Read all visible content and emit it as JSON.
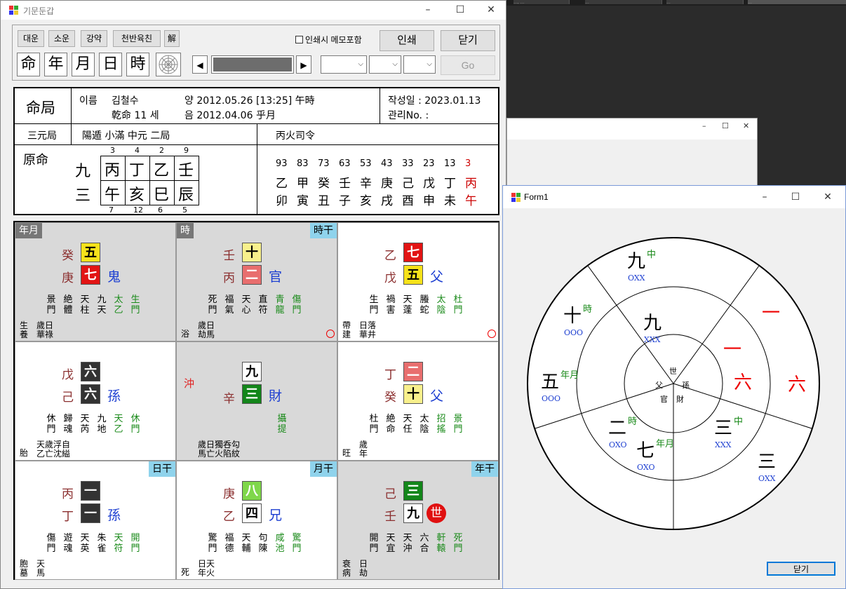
{
  "taskbar_tabs": [
    "..., ...",
    "...",
    "...",
    "..."
  ],
  "bg_window": {
    "ctrl_min": "–",
    "ctrl_max": "☐",
    "ctrl_close": "✕"
  },
  "main": {
    "title": "기문둔갑",
    "toolbar": {
      "btn_daeun": "대운",
      "btn_soun": "소운",
      "btn_gangyak": "강약",
      "btn_cheonban": "천반육친",
      "btn_hae": "解",
      "btn_ming": "命",
      "btn_year": "年",
      "btn_month": "月",
      "btn_day": "日",
      "btn_hour": "時",
      "print_memo": "인쇄시 메모포함",
      "print": "인쇄",
      "close": "닫기",
      "go": "Go"
    },
    "header": {
      "title": "命局",
      "name_label": "이름",
      "name_value": "김철수",
      "solar": "양 2012.05.26  [13:25]  午時",
      "lunar": "음 2012.04.06  乎月",
      "gender_age": "乾命 11 세",
      "written": "작성일 : 2023.01.13",
      "manage": "관리No. :",
      "sanwon": "三元局",
      "sanwon_val": "陽遁 小滿 中元 二局",
      "siryeong": "丙火司令",
      "wonmyeong": "原命"
    },
    "pillars": {
      "left_top": "九",
      "left_bottom": "三",
      "top_nums": [
        "3",
        "4",
        "2",
        "9"
      ],
      "stems": [
        "丙",
        "丁",
        "乙",
        "壬"
      ],
      "branches": [
        "午",
        "亥",
        "巳",
        "辰"
      ],
      "bottom_nums": [
        "7",
        "12",
        "6",
        "5"
      ]
    },
    "daeun": {
      "ages": [
        "93",
        "83",
        "73",
        "63",
        "53",
        "43",
        "33",
        "23",
        "13",
        "3"
      ],
      "stems": [
        "乙",
        "甲",
        "癸",
        "壬",
        "辛",
        "庚",
        "己",
        "戊",
        "丁",
        "丙"
      ],
      "branches": [
        "卯",
        "寅",
        "丑",
        "子",
        "亥",
        "戌",
        "酉",
        "申",
        "未",
        "午"
      ]
    },
    "palaces": [
      {
        "tl": "年月",
        "tr": "",
        "s1": "癸",
        "s2": "庚",
        "b1": "五",
        "b2": "七",
        "rel": "鬼",
        "cols": [
          [
            "景",
            "門"
          ],
          [
            "絶",
            "體"
          ],
          [
            "天",
            "柱"
          ],
          [
            "九",
            "天"
          ],
          [
            "太",
            "乙"
          ],
          [
            "生",
            "門"
          ]
        ],
        "bl1": "生",
        "bl2": "養",
        "bt1": "歲日",
        "bt2": "華祿",
        "circle": ""
      },
      {
        "tl": "時",
        "tr": "時干",
        "s1": "壬",
        "s2": "丙",
        "b1": "十",
        "b2": "二",
        "rel": "官",
        "cols": [
          [
            "死",
            "門"
          ],
          [
            "福",
            "氣"
          ],
          [
            "天",
            "心"
          ],
          [
            "直",
            "符"
          ],
          [
            "青",
            "龍"
          ],
          [
            "傷",
            "門"
          ]
        ],
        "bl1": "浴",
        "bl2": "",
        "bt1": "歲日",
        "bt2": "劫馬",
        "circle": "○"
      },
      {
        "tl": "",
        "tr": "",
        "s1": "乙",
        "s2": "戊",
        "b1": "七",
        "b2": "五",
        "rel": "父",
        "cols": [
          [
            "生",
            "門"
          ],
          [
            "禍",
            "害"
          ],
          [
            "天",
            "蓬"
          ],
          [
            "螣",
            "蛇"
          ],
          [
            "太",
            "陰"
          ],
          [
            "杜",
            "門"
          ]
        ],
        "bl1": "帶",
        "bl2": "建",
        "bt1": "日落",
        "bt2": "華井",
        "circle": "○"
      },
      {
        "tl": "",
        "tr": "",
        "s1": "戊",
        "s2": "己",
        "b1": "六",
        "b2": "六",
        "rel": "孫",
        "cols": [
          [
            "休",
            "門"
          ],
          [
            "歸",
            "魂"
          ],
          [
            "天",
            "芮"
          ],
          [
            "九",
            "地"
          ],
          [
            "天",
            "乙"
          ],
          [
            "休",
            "門"
          ]
        ],
        "bl1": "胎",
        "bl2": "",
        "bt1": "天歲浮自",
        "bt2": "乙亡沈縊",
        "circle": ""
      },
      {
        "tl": "",
        "tr": "",
        "s1": "沖",
        "s2": "辛",
        "b1": "九",
        "b2": "三",
        "rel": "財",
        "cols": [],
        "extra1": "攝",
        "extra2": "提",
        "bl1": "",
        "bl2": "",
        "bt1": "歲日獨呑勾",
        "bt2": "馬亡火陷紋",
        "circle": ""
      },
      {
        "tl": "",
        "tr": "",
        "s1": "丁",
        "s2": "癸",
        "b1": "二",
        "b2": "十",
        "rel": "父",
        "cols": [
          [
            "杜",
            "門"
          ],
          [
            "絶",
            "命"
          ],
          [
            "天",
            "任"
          ],
          [
            "太",
            "陰"
          ],
          [
            "招",
            "搖"
          ],
          [
            "景",
            "門"
          ]
        ],
        "bl1": "旺",
        "bl2": "",
        "bt1": "歲",
        "bt2": "年",
        "circle": ""
      },
      {
        "tl": "",
        "tr": "日干",
        "s1": "丙",
        "s2": "丁",
        "b1": "一",
        "b2": "一",
        "rel": "孫",
        "cols": [
          [
            "傷",
            "門"
          ],
          [
            "遊",
            "魂"
          ],
          [
            "天",
            "英"
          ],
          [
            "朱",
            "雀"
          ],
          [
            "天",
            "符"
          ],
          [
            "開",
            "門"
          ]
        ],
        "bl1": "胞",
        "bl2": "墓",
        "bt1": "天",
        "bt2": "馬",
        "circle": ""
      },
      {
        "tl": "",
        "tr": "月干",
        "s1": "庚",
        "s2": "乙",
        "b1": "八",
        "b2": "四",
        "rel": "兄",
        "cols": [
          [
            "驚",
            "門"
          ],
          [
            "福",
            "德"
          ],
          [
            "天",
            "輔"
          ],
          [
            "句",
            "陳"
          ],
          [
            "咸",
            "池"
          ],
          [
            "驚",
            "門"
          ]
        ],
        "bl1": "死",
        "bl2": "",
        "bt1": "日天",
        "bt2": "年火",
        "circle": ""
      },
      {
        "tl": "",
        "tr": "年干",
        "s1": "己",
        "s2": "壬",
        "b1": "三",
        "b2": "九",
        "rel": "世",
        "cols": [
          [
            "開",
            "門"
          ],
          [
            "天",
            "宜"
          ],
          [
            "天",
            "沖"
          ],
          [
            "六",
            "合"
          ],
          [
            "軒",
            "轅"
          ],
          [
            "死",
            "門"
          ]
        ],
        "bl1": "衰",
        "bl2": "病",
        "bt1": "日",
        "bt2": "劫",
        "circle": ""
      }
    ]
  },
  "form1": {
    "title": "Form1",
    "close_button": "닫기",
    "outer": [
      {
        "main": "九",
        "sup": "中",
        "code": "OXX"
      },
      {
        "main": "十",
        "sup": "時",
        "code": "OOO"
      },
      {
        "main": "五",
        "sup": "年月",
        "code": "OOO"
      },
      {
        "main": "二",
        "sup": "時",
        "code": "OXO"
      },
      {
        "main": "七",
        "sup": "年月",
        "code": "OXO"
      },
      {
        "main": "三",
        "sup": "中",
        "code": "XXX"
      },
      {
        "main": "三",
        "sup": "",
        "code": "OXX"
      },
      {
        "main": "一",
        "sup": "",
        "code": ""
      },
      {
        "main": "六",
        "sup": "",
        "code": ""
      }
    ],
    "middle": [
      {
        "main": "九",
        "code": "XXX"
      },
      {
        "main": "一",
        "code": ""
      },
      {
        "main": "六",
        "code": ""
      }
    ],
    "center": {
      "top": "世",
      "left": "父",
      "right": "孫",
      "bl": "官",
      "br": "財"
    }
  }
}
